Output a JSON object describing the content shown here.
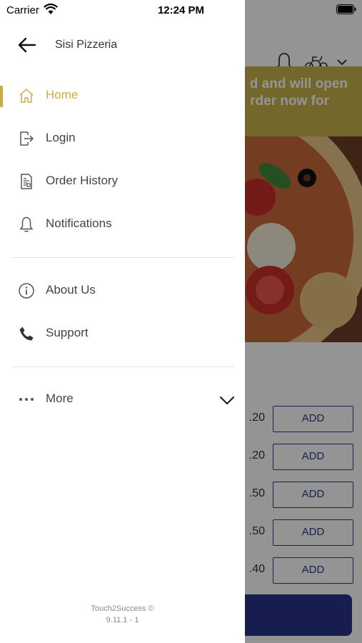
{
  "status_bar": {
    "carrier": "Carrier",
    "time": "12:24 PM"
  },
  "drawer": {
    "title": "Sisi Pizzeria",
    "menu_primary": [
      {
        "label": "Home",
        "icon": "home-icon",
        "active": true
      },
      {
        "label": "Login",
        "icon": "login-icon"
      },
      {
        "label": "Order History",
        "icon": "order-history-icon"
      },
      {
        "label": "Notifications",
        "icon": "bell-icon"
      }
    ],
    "menu_secondary": [
      {
        "label": "About Us",
        "icon": "info-icon"
      },
      {
        "label": "Support",
        "icon": "phone-icon"
      }
    ],
    "more": {
      "label": "More",
      "icon": "more-dots-icon"
    },
    "footer": {
      "brand": "Touch2Success ©",
      "version": "9.11.1 - 1"
    }
  },
  "background": {
    "banner_line1": "d and will open",
    "banner_line2": "rder now for",
    "rows": [
      {
        "price": ".20",
        "add": "ADD"
      },
      {
        "price": ".20",
        "add": "ADD"
      },
      {
        "price": ".50",
        "add": "ADD"
      },
      {
        "price": ".50",
        "add": "ADD"
      },
      {
        "price": ".40",
        "add": "ADD"
      }
    ]
  },
  "colors": {
    "accent": "#c9ac47",
    "brand_blue": "#2a338a",
    "banner": "#c9b24a"
  }
}
